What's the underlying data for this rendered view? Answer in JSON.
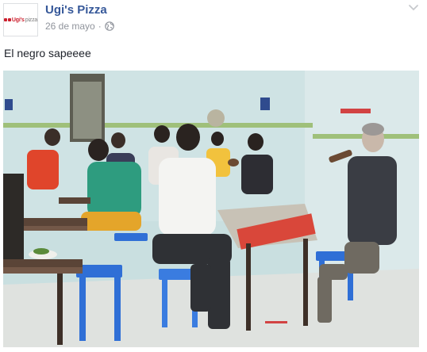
{
  "page": {
    "name": "Ugi's Pizza",
    "logo_text": "Ugi's",
    "logo_word": "pizza"
  },
  "meta": {
    "date": "26 de mayo",
    "separator": "·",
    "audience_icon": "globe-icon"
  },
  "post": {
    "text": "El negro sapeeee",
    "photo_description_icon": "photo"
  },
  "menu": {
    "icon": "chevron-down-icon"
  },
  "colors": {
    "link": "#365899",
    "meta": "#90949c",
    "logo_red": "#cc1f2d"
  }
}
